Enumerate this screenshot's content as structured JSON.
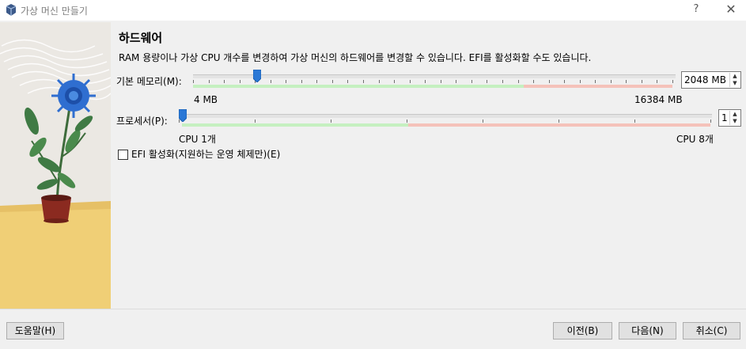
{
  "window": {
    "title": "가상 머신 만들기",
    "help_glyph": "?",
    "close_glyph": "✕"
  },
  "page": {
    "heading": "하드웨어",
    "description": "RAM 용량이나 가상 CPU 개수를 변경하여 가상 머신의 하드웨어를 변경할 수 있습니다. EFI를 활성화할 수도 있습니다."
  },
  "memory": {
    "label": "기본 메모리(M):",
    "min_label": "4 MB",
    "max_label": "16384 MB",
    "value": "2048 MB",
    "value_fraction": 0.125
  },
  "processor": {
    "label": "프로세서(P):",
    "min_label": "CPU 1개",
    "max_label": "CPU 8개",
    "value": "1",
    "value_fraction": 0
  },
  "efi": {
    "label": "EFI 활성화(지원하는 운영 체제만)(E)",
    "checked": false
  },
  "footer": {
    "help": "도움말(H)",
    "back": "이전(B)",
    "next": "다음(N)",
    "cancel": "취소(C)"
  },
  "colors": {
    "slider_green": "#c5f0c0",
    "slider_red": "#f5c2ba",
    "handle_blue": "#2a78d6",
    "side_yellow": "#f0cf76"
  }
}
